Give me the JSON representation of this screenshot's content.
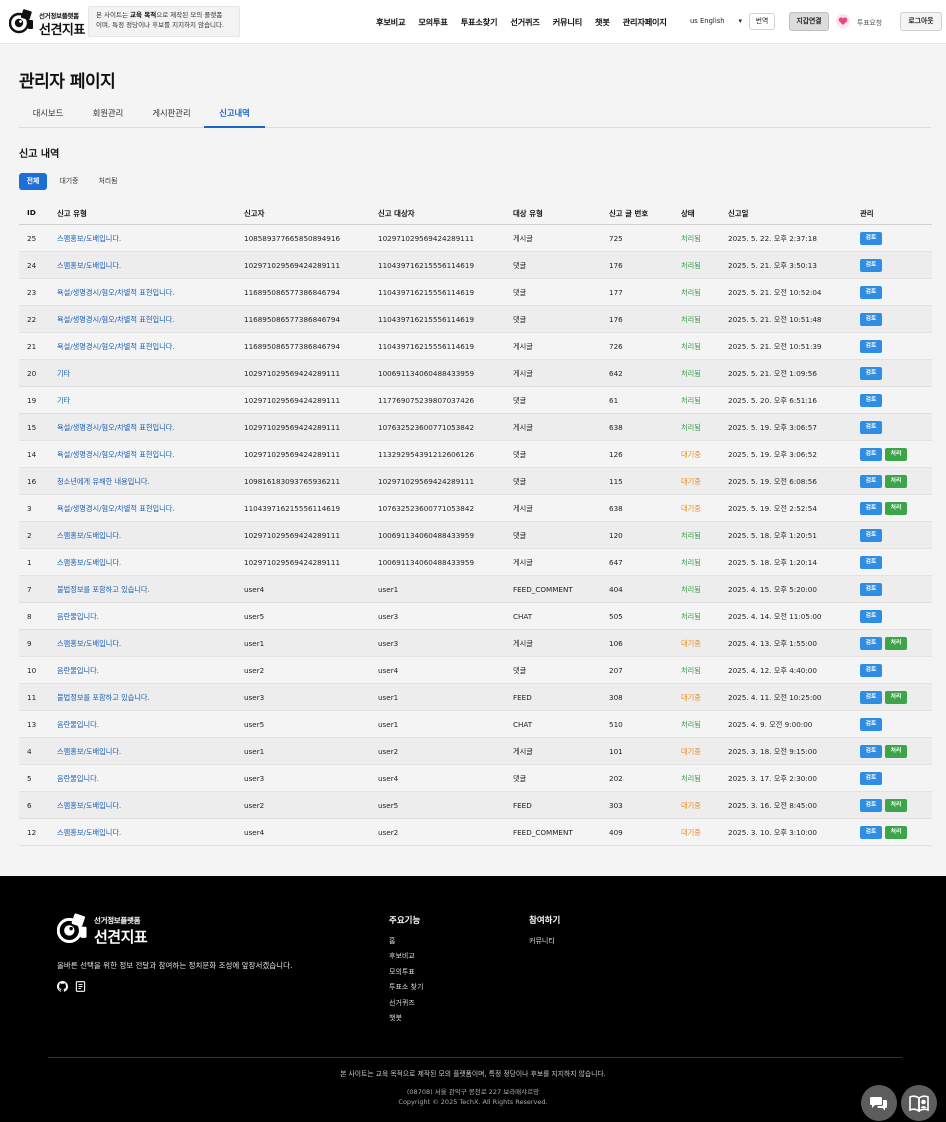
{
  "header": {
    "logo_sub": "선거정보플랫폼",
    "logo_main": "선견지표",
    "notice_prefix": "본 사이트는 ",
    "notice_bold": "교육 목적",
    "notice_suffix": "으로 제작된 모의 플랫폼",
    "notice_line2": "이며, 특정 정당이나 후보를 지지하지 않습니다.",
    "nav": [
      "후보비교",
      "모의투표",
      "투표소찾기",
      "선거퀴즈",
      "커뮤니티",
      "챗봇",
      "관리자페이지"
    ],
    "language": "us English",
    "translate": "번역",
    "wallet": "지갑연결",
    "vote_request": "투표요청",
    "logout": "로그아웃"
  },
  "page_title": "관리자 페이지",
  "tabs": [
    "대시보드",
    "회원관리",
    "게시판관리",
    "신고내역"
  ],
  "active_tab": "신고내역",
  "section_title": "신고 내역",
  "filters": [
    "전체",
    "대기중",
    "처리됨"
  ],
  "table": {
    "headers": [
      "ID",
      "신고 유형",
      "신고자",
      "신고 대상자",
      "대상 유형",
      "신고 글 번호",
      "상태",
      "신고일",
      "관리"
    ],
    "review_label": "검토",
    "process_label": "처리",
    "rows": [
      {
        "id": "25",
        "type": "스팸홍보/도배입니다.",
        "reporter": "108589377665850894916",
        "target": "102971029569424289111",
        "target_type": "게시글",
        "post": "725",
        "status": "처리됨",
        "date": "2025. 5. 22. 오후 2:37:18"
      },
      {
        "id": "24",
        "type": "스팸홍보/도배입니다.",
        "reporter": "102971029569424289111",
        "target": "110439716215556114619",
        "target_type": "댓글",
        "post": "176",
        "status": "처리됨",
        "date": "2025. 5. 21. 오후 3:50:13"
      },
      {
        "id": "23",
        "type": "욕설/생명경시/혐오/차별적 표현입니다.",
        "reporter": "116895086577386846794",
        "target": "110439716215556114619",
        "target_type": "댓글",
        "post": "177",
        "status": "처리됨",
        "date": "2025. 5. 21. 오전 10:52:04"
      },
      {
        "id": "22",
        "type": "욕설/생명경시/혐오/차별적 표현입니다.",
        "reporter": "116895086577386846794",
        "target": "110439716215556114619",
        "target_type": "댓글",
        "post": "176",
        "status": "처리됨",
        "date": "2025. 5. 21. 오전 10:51:48"
      },
      {
        "id": "21",
        "type": "욕설/생명경시/혐오/차별적 표현입니다.",
        "reporter": "116895086577386846794",
        "target": "110439716215556114619",
        "target_type": "게시글",
        "post": "726",
        "status": "처리됨",
        "date": "2025. 5. 21. 오전 10:51:39"
      },
      {
        "id": "20",
        "type": "기타",
        "reporter": "102971029569424289111",
        "target": "100691134060488433959",
        "target_type": "게시글",
        "post": "642",
        "status": "처리됨",
        "date": "2025. 5. 21. 오전 1:09:56"
      },
      {
        "id": "19",
        "type": "기타",
        "reporter": "102971029569424289111",
        "target": "117769075239807037426",
        "target_type": "댓글",
        "post": "61",
        "status": "처리됨",
        "date": "2025. 5. 20. 오후 6:51:16"
      },
      {
        "id": "15",
        "type": "욕설/생명경시/혐오/차별적 표현입니다.",
        "reporter": "102971029569424289111",
        "target": "107632523600771053842",
        "target_type": "게시글",
        "post": "638",
        "status": "처리됨",
        "date": "2025. 5. 19. 오후 3:06:57"
      },
      {
        "id": "14",
        "type": "욕설/생명경시/혐오/차별적 표현입니다.",
        "reporter": "102971029569424289111",
        "target": "113292954391212606126",
        "target_type": "댓글",
        "post": "126",
        "status": "대기중",
        "date": "2025. 5. 19. 오후 3:06:52"
      },
      {
        "id": "16",
        "type": "청소년에게 유해한 내용입니다.",
        "reporter": "109816183093765936211",
        "target": "102971029569424289111",
        "target_type": "댓글",
        "post": "115",
        "status": "대기중",
        "date": "2025. 5. 19. 오전 6:08:56"
      },
      {
        "id": "3",
        "type": "욕설/생명경시/혐오/차별적 표현입니다.",
        "reporter": "110439716215556114619",
        "target": "107632523600771053842",
        "target_type": "게시글",
        "post": "638",
        "status": "대기중",
        "date": "2025. 5. 19. 오전 2:52:54"
      },
      {
        "id": "2",
        "type": "스팸홍보/도배입니다.",
        "reporter": "102971029569424289111",
        "target": "100691134060488433959",
        "target_type": "댓글",
        "post": "120",
        "status": "처리됨",
        "date": "2025. 5. 18. 오후 1:20:51"
      },
      {
        "id": "1",
        "type": "스팸홍보/도배입니다.",
        "reporter": "102971029569424289111",
        "target": "100691134060488433959",
        "target_type": "게시글",
        "post": "647",
        "status": "처리됨",
        "date": "2025. 5. 18. 오후 1:20:14"
      },
      {
        "id": "7",
        "type": "불법정보를 포함하고 있습니다.",
        "reporter": "user4",
        "target": "user1",
        "target_type": "FEED_COMMENT",
        "post": "404",
        "status": "처리됨",
        "date": "2025. 4. 15. 오후 5:20:00"
      },
      {
        "id": "8",
        "type": "음란물입니다.",
        "reporter": "user5",
        "target": "user3",
        "target_type": "CHAT",
        "post": "505",
        "status": "처리됨",
        "date": "2025. 4. 14. 오전 11:05:00"
      },
      {
        "id": "9",
        "type": "스팸홍보/도배입니다.",
        "reporter": "user1",
        "target": "user3",
        "target_type": "게시글",
        "post": "106",
        "status": "대기중",
        "date": "2025. 4. 13. 오후 1:55:00"
      },
      {
        "id": "10",
        "type": "음란물입니다.",
        "reporter": "user2",
        "target": "user4",
        "target_type": "댓글",
        "post": "207",
        "status": "처리됨",
        "date": "2025. 4. 12. 오후 4:40:00"
      },
      {
        "id": "11",
        "type": "불법정보를 포함하고 있습니다.",
        "reporter": "user3",
        "target": "user1",
        "target_type": "FEED",
        "post": "308",
        "status": "대기중",
        "date": "2025. 4. 11. 오전 10:25:00"
      },
      {
        "id": "13",
        "type": "음란물입니다.",
        "reporter": "user5",
        "target": "user1",
        "target_type": "CHAT",
        "post": "510",
        "status": "처리됨",
        "date": "2025. 4. 9. 오전 9:00:00"
      },
      {
        "id": "4",
        "type": "스팸홍보/도배입니다.",
        "reporter": "user1",
        "target": "user2",
        "target_type": "게시글",
        "post": "101",
        "status": "대기중",
        "date": "2025. 3. 18. 오전 9:15:00"
      },
      {
        "id": "5",
        "type": "음란물입니다.",
        "reporter": "user3",
        "target": "user4",
        "target_type": "댓글",
        "post": "202",
        "status": "처리됨",
        "date": "2025. 3. 17. 오후 2:30:00"
      },
      {
        "id": "6",
        "type": "스팸홍보/도배입니다.",
        "reporter": "user2",
        "target": "user5",
        "target_type": "FEED",
        "post": "303",
        "status": "대기중",
        "date": "2025. 3. 16. 오전 8:45:00"
      },
      {
        "id": "12",
        "type": "스팸홍보/도배입니다.",
        "reporter": "user4",
        "target": "user2",
        "target_type": "FEED_COMMENT",
        "post": "409",
        "status": "대기중",
        "date": "2025. 3. 10. 오후 3:10:00"
      }
    ]
  },
  "footer": {
    "logo_sub": "선거정보플랫폼",
    "logo_main": "선견지표",
    "tagline": "올바른 선택을 위한 정보 전달과 참여하는 정치문화 조성에 앞장서겠습니다.",
    "features_title": "주요기능",
    "features": [
      "홈",
      "후보비교",
      "모의투표",
      "투표소 찾기",
      "선거퀴즈",
      "챗봇"
    ],
    "participate_title": "참여하기",
    "participate": [
      "커뮤니티"
    ],
    "disclaimer": "본 사이트는 교육 목적으로 제작된 모의 플랫폼이며, 특정 정당이나 후보를 지지하지 않습니다.",
    "address": "(08708) 서울 관악구 봉천로 227 보라매샤르망",
    "copyright": "Copyright © 2025 TechX. All Rights Reserved."
  },
  "icons": {
    "github": "github-icon",
    "blog": "blog-icon",
    "chat": "chat-icon",
    "book": "book-icon"
  },
  "colors": {
    "accent": "#1c6fd6",
    "link": "#1a5fb4",
    "done": "#3aa047",
    "wait": "#ef8a14",
    "review_button": "#2f8de4",
    "process_button": "#3da549"
  }
}
